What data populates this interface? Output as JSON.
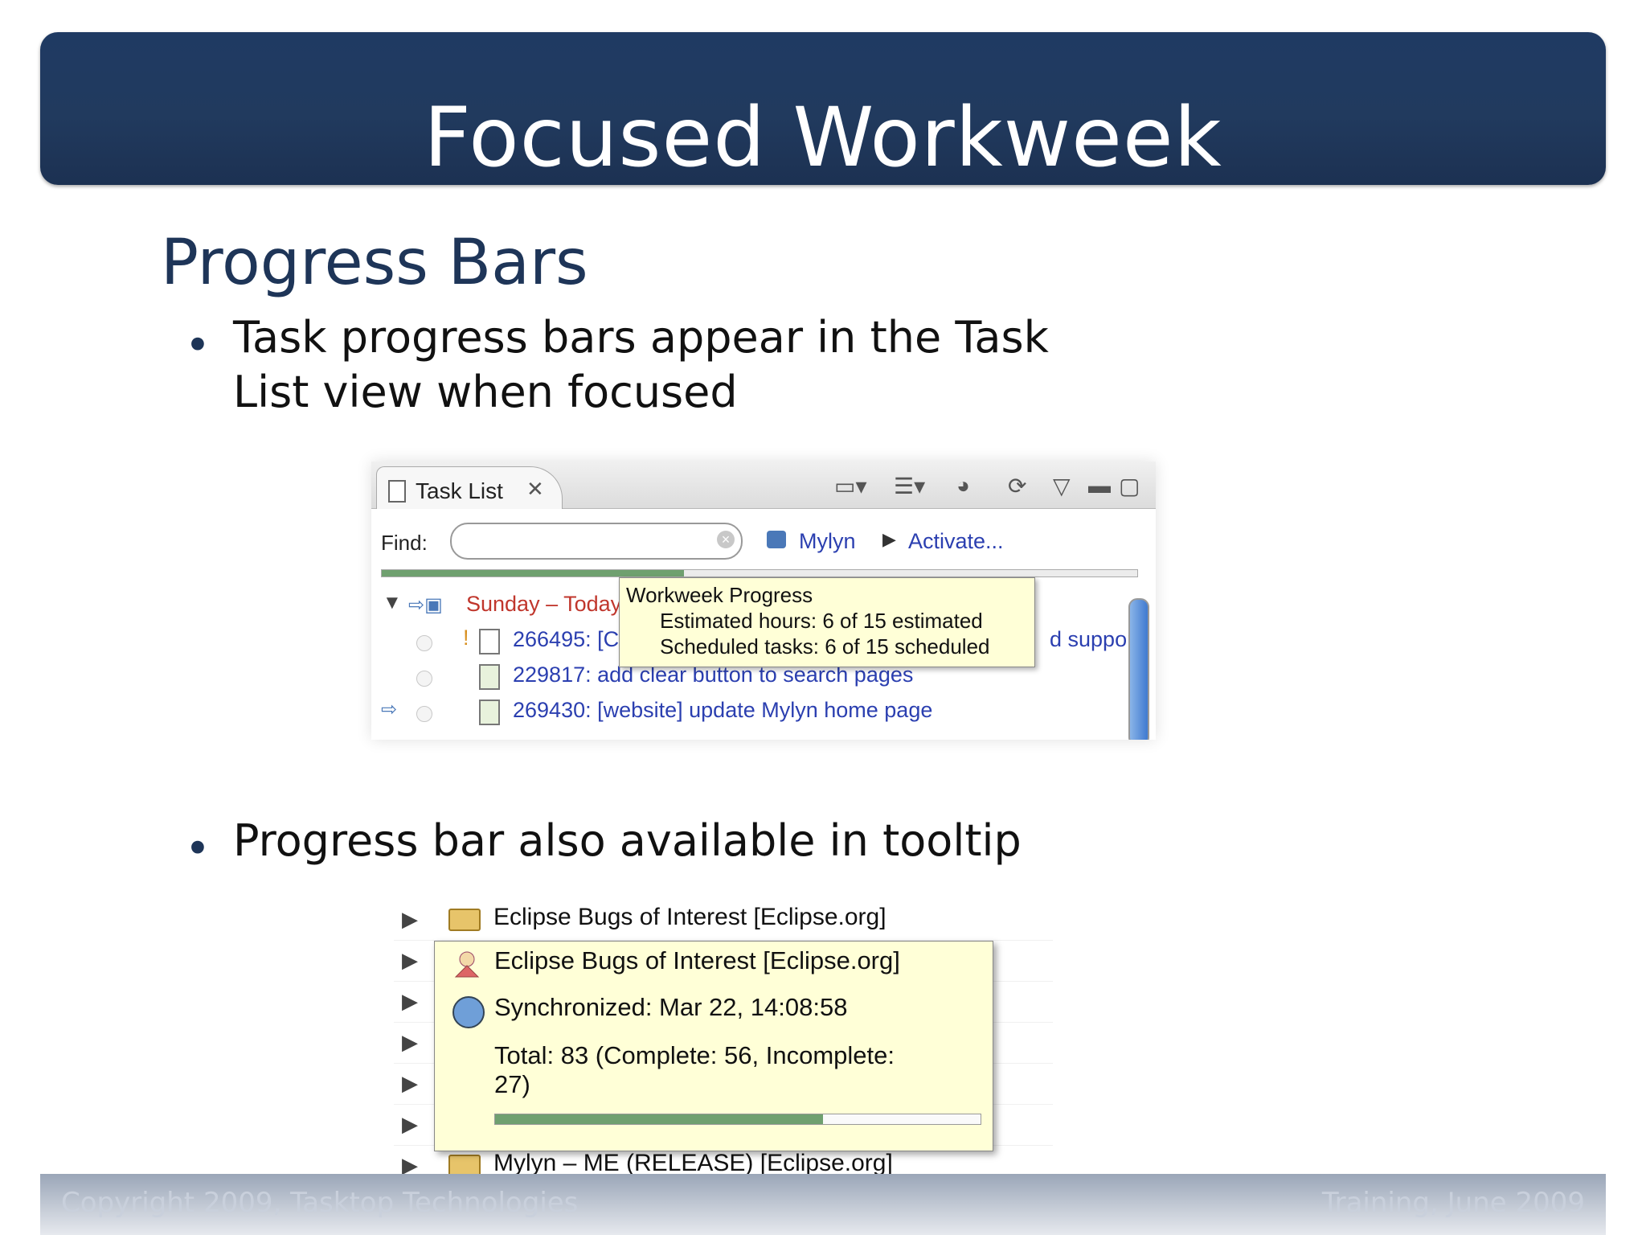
{
  "slide": {
    "title": "Focused Workweek",
    "heading": "Progress Bars",
    "bullets": [
      "Task progress bars appear in the Task List view when focused",
      "Progress bar also available in tooltip"
    ]
  },
  "task_list_view": {
    "tab_label": "Task List",
    "find_label": "Find:",
    "search_value": "",
    "context": "Mylyn",
    "activate_label": "Activate...",
    "workweek_progress": 0.4,
    "rows": [
      {
        "text": "Sunday – Today",
        "color": "#c0362c"
      },
      {
        "text": "266495: [C",
        "suffix": "d suppor"
      },
      {
        "text": "229817: add clear button to search pages"
      },
      {
        "text": "269430: [website] update Mylyn home page"
      }
    ],
    "tooltip": {
      "title": "Workweek Progress",
      "estimated": "Estimated hours: 6 of 15 estimated",
      "scheduled": "Scheduled tasks: 6 of 15 scheduled"
    }
  },
  "query_tooltip_view": {
    "rows": [
      "Eclipse Bugs of Interest   [Eclipse.org]",
      "",
      "",
      "",
      "",
      "",
      "Mylyn – ME (RELEASE)   [Eclipse.org]"
    ],
    "tooltip": {
      "title": "Eclipse Bugs of Interest  [Eclipse.org]",
      "synchronized": "Synchronized: Mar 22, 14:08:58",
      "total_line1": "Total: 83 (Complete: 56, Incomplete:",
      "total_line2": "27)",
      "progress": 0.675
    }
  },
  "footer": {
    "left": "Copyright 2009, Tasktop Technologies",
    "right": "Training, June 2009"
  },
  "colors": {
    "title_bar": "#213a5e",
    "heading": "#1e3558",
    "link": "#2b3fb0",
    "progress": "#6fa06f",
    "tooltip_bg": "#ffffd7"
  }
}
